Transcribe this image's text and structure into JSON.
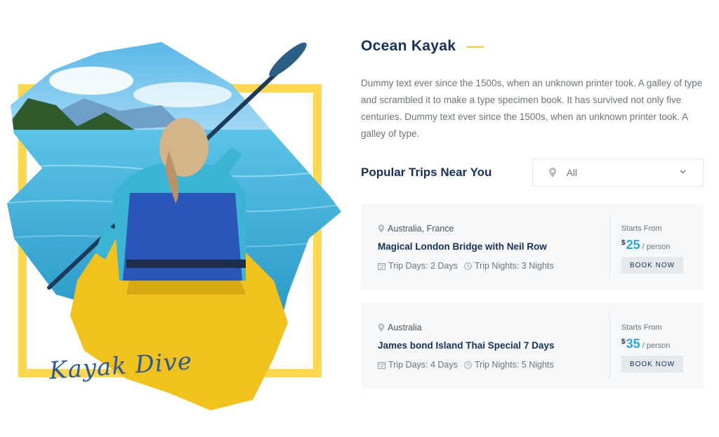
{
  "colors": {
    "accent_yellow": "#ffd84d",
    "navy": "#14305c",
    "price_blue": "#2aa6e0",
    "card_bg": "#f6f7f9"
  },
  "hero": {
    "title": "Ocean Kayak",
    "description": "Dummy text ever since the 1500s, when an unknown printer took. A galley of type and scrambled it to make a type specimen book. It has survived not only five centuries. Dummy text ever since the 1500s, when an unknown printer took. A galley of type.",
    "image_caption": "Kayak Dive"
  },
  "trips": {
    "heading": "Popular Trips Near You",
    "filter": {
      "icon": "map-pin-icon",
      "selected": "All"
    },
    "items": [
      {
        "location": "Australia, France",
        "name": "Magical London Bridge with Neil Row",
        "days": "Trip Days: 2 Days",
        "nights": "Trip Nights: 3 Nights",
        "starts_label": "Starts From",
        "currency": "$",
        "price": "25",
        "per": "/ person",
        "button": "BOOK NOW"
      },
      {
        "location": "Australia",
        "name": "James bond Island Thai Special 7 Days",
        "days": "Trip Days: 4 Days",
        "nights": "Trip Nights: 5 Nights",
        "starts_label": "Starts From",
        "currency": "$",
        "price": "35",
        "per": "/ person",
        "button": "BOOK NOW"
      }
    ]
  }
}
